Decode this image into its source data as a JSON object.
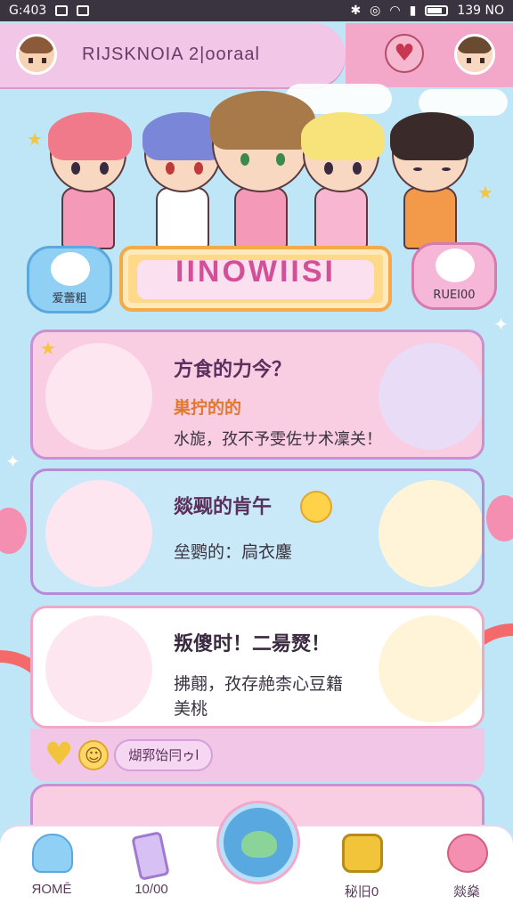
{
  "status_bar": {
    "left_text": "G:403",
    "right_text": "139 NO"
  },
  "header": {
    "title": "RIJSKNOIA 2|ooraal"
  },
  "banner": {
    "title": "IINOWIISI",
    "left_mascot_label": "爱蕾粗",
    "right_mascot_label": "RUEI00"
  },
  "cards": [
    {
      "line1": "方食的力今？",
      "line2": "巣拧的的",
      "line3": "水旎，孜不予雯佐サ术凜关！"
    },
    {
      "line1": "燚觋的肯午",
      "line2": "垒鹦的：扃衣鏖"
    },
    {
      "line1": "叛傻时！二昜燹！",
      "line2": "拂翸，孜存赩柰心豆籍",
      "line3": "美桃"
    }
  ],
  "chip": {
    "label": "煳郛饴冃ゥl"
  },
  "nav": [
    {
      "label": "ЯOMĒ",
      "icon": "cloud-icon"
    },
    {
      "label": "10/00",
      "icon": "phone-icon"
    },
    {
      "label": "",
      "icon": "center-mascot-icon"
    },
    {
      "label": "秘旧0",
      "icon": "goggles-icon"
    },
    {
      "label": "燚燊",
      "icon": "pink-blob-icon"
    }
  ],
  "colors": {
    "pink": "#f3a7c9",
    "lavender": "#f1c6e6",
    "sky": "#bfe6f6",
    "gold": "#ffd98a",
    "accent": "#d34f98"
  }
}
